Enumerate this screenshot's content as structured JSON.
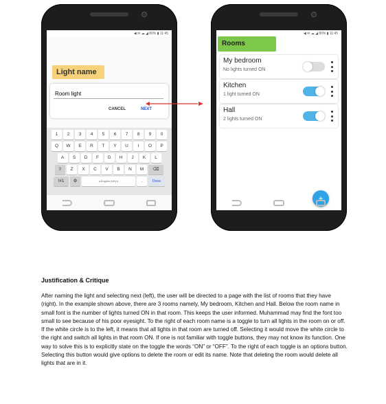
{
  "left_phone": {
    "status_bar": "◀ ✉ ☁ ◢ 80% ▮ 11:45",
    "title": "Light name",
    "input_value": "Room light",
    "cancel_label": "CANCEL",
    "next_label": "NEXT",
    "keyboard": {
      "row1": [
        "1",
        "2",
        "3",
        "4",
        "5",
        "6",
        "7",
        "8",
        "9",
        "0"
      ],
      "row2": [
        "Q",
        "W",
        "E",
        "R",
        "T",
        "Y",
        "U",
        "I",
        "O",
        "P"
      ],
      "row3": [
        "A",
        "S",
        "D",
        "F",
        "G",
        "H",
        "J",
        "K",
        "L"
      ],
      "row4": [
        "⇧",
        "Z",
        "X",
        "C",
        "V",
        "B",
        "N",
        "M",
        "⌫"
      ],
      "symbols_label": "!#1",
      "settings_glyph": "⚙",
      "space_label": "◂ English (UK) ▸",
      "period_label": ".",
      "done_label": "Done"
    }
  },
  "right_phone": {
    "status_bar": "◀ ✉ ☁ ◢ 80% ▮ 11:45",
    "title": "Rooms",
    "rooms": [
      {
        "name": "My bedroom",
        "status": "No lights turned ON",
        "on": false
      },
      {
        "name": "Kitchen",
        "status": "1 light turned ON",
        "on": true
      },
      {
        "name": "Hall",
        "status": "2 lights turned ON",
        "on": true
      }
    ],
    "fab_label": "+"
  },
  "colors": {
    "light_name_chip": "#f7d27a",
    "rooms_chip": "#7dc74b",
    "toggle_on": "#4fb3e8",
    "fab": "#2ea3e6",
    "next_button": "#2155c7",
    "arrow": "#e0312b"
  },
  "text": {
    "heading": "Justification & Critique",
    "paragraph": "After naming the light and selecting next (left), the user will be directed to a page with the list of rooms that they have (right). In the example shown above, there are 3 rooms namely, My bedroom, Kitchen and Hall. Below the room name in small font is the number of lights turned ON in that room. This keeps the user informed. Muhammad may find the font too small to see because of his poor eyesight. To the right of each room name is a toggle to turn all lights in the room on or off. If the white circle is to the left, it means that all lights in that room are turned off. Selecting it would move the white circle to the right and switch all lights in that room ON. If one is not familiar with toggle buttons, they may not know its function. One way to solve this is to explicitly state on the toggle the words “ON” or “OFF”. To the right of each toggle is an options button. Selecting this button would give options to delete the room or edit its name. Note that deleting the room would delete all lights that are in it."
  }
}
